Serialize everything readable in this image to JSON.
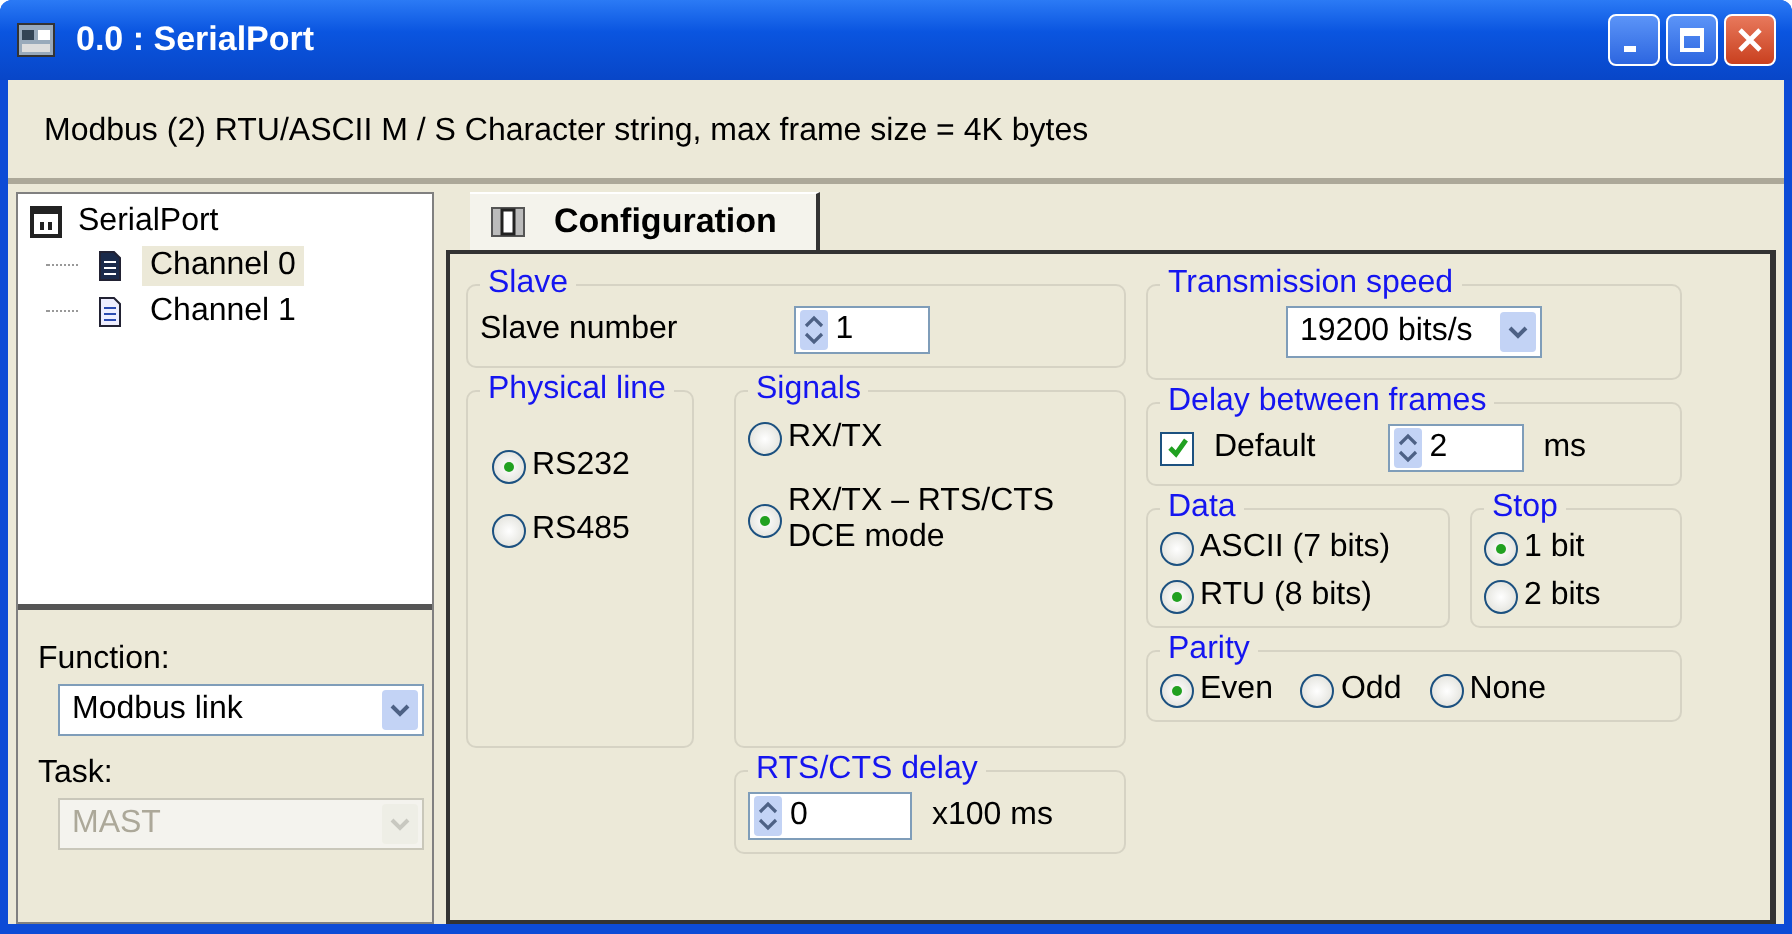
{
  "window": {
    "title": "0.0 : SerialPort"
  },
  "info_text": "Modbus (2) RTU/ASCII M / S Character string, max frame size = 4K bytes",
  "tree": {
    "label": "SerialPort",
    "children": [
      {
        "label": "Channel 0",
        "selected": true
      },
      {
        "label": "Channel 1",
        "selected": false
      }
    ]
  },
  "function": {
    "label": "Function:",
    "value": "Modbus link",
    "disabled": false
  },
  "task": {
    "label": "Task:",
    "value": "MAST",
    "disabled": true
  },
  "tabs": [
    {
      "label": "Configuration",
      "selected": true
    }
  ],
  "slave": {
    "title": "Slave",
    "label": "Slave number",
    "value": "1"
  },
  "physical_line": {
    "title": "Physical line",
    "options": [
      {
        "label": "RS232",
        "selected": true
      },
      {
        "label": "RS485",
        "selected": false
      }
    ]
  },
  "signals": {
    "title": "Signals",
    "options": [
      {
        "label": "RX/TX",
        "selected": false
      },
      {
        "label": "RX/TX – RTS/CTS DCE mode",
        "selected": true
      }
    ]
  },
  "rts_cts_delay": {
    "title": "RTS/CTS delay",
    "value": "0",
    "unit": "x100 ms"
  },
  "transmission_speed": {
    "title": "Transmission speed",
    "value": "19200 bits/s"
  },
  "delay_between_frames": {
    "title": "Delay between frames",
    "default_label": "Default",
    "default_checked": true,
    "value": "2",
    "unit": "ms"
  },
  "data": {
    "title": "Data",
    "options": [
      {
        "label": "ASCII (7 bits)",
        "selected": false
      },
      {
        "label": "RTU (8 bits)",
        "selected": true
      }
    ]
  },
  "stop": {
    "title": "Stop",
    "options": [
      {
        "label": "1 bit",
        "selected": true
      },
      {
        "label": "2 bits",
        "selected": false
      }
    ]
  },
  "parity": {
    "title": "Parity",
    "options": [
      {
        "label": "Even",
        "selected": true
      },
      {
        "label": "Odd",
        "selected": false
      },
      {
        "label": "None",
        "selected": false
      }
    ]
  }
}
